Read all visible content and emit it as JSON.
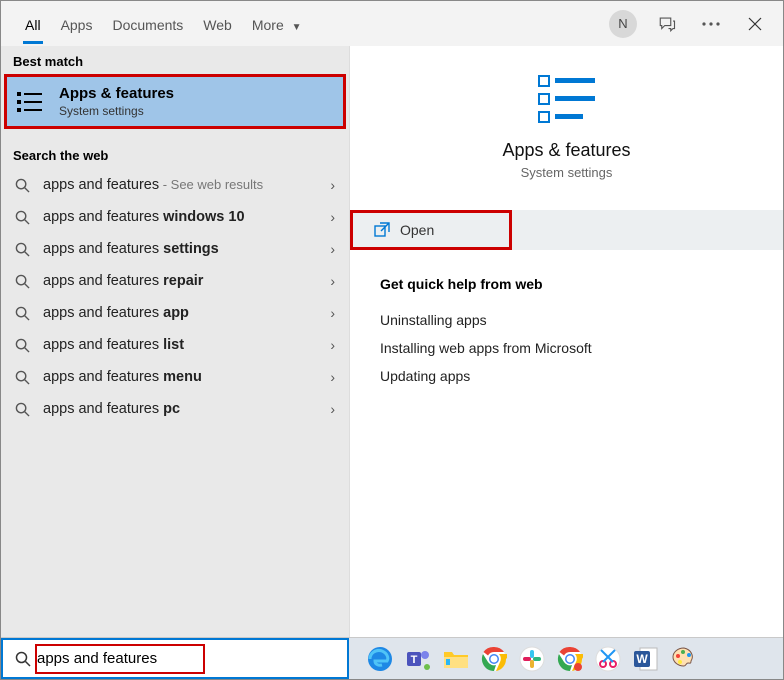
{
  "tabs": {
    "all": "All",
    "apps": "Apps",
    "documents": "Documents",
    "web": "Web",
    "more": "More"
  },
  "user_initial": "N",
  "sections": {
    "best_match": "Best match",
    "search_web": "Search the web"
  },
  "best_match": {
    "title": "Apps & features",
    "subtitle": "System settings"
  },
  "web_results": [
    {
      "prefix": "apps and features",
      "bold": "",
      "hint": " - See web results"
    },
    {
      "prefix": "apps and features ",
      "bold": "windows 10",
      "hint": ""
    },
    {
      "prefix": "apps and features ",
      "bold": "settings",
      "hint": ""
    },
    {
      "prefix": "apps and features ",
      "bold": "repair",
      "hint": ""
    },
    {
      "prefix": "apps and features ",
      "bold": "app",
      "hint": ""
    },
    {
      "prefix": "apps and features ",
      "bold": "list",
      "hint": ""
    },
    {
      "prefix": "apps and features ",
      "bold": "menu",
      "hint": ""
    },
    {
      "prefix": "apps and features ",
      "bold": "pc",
      "hint": ""
    }
  ],
  "preview": {
    "title": "Apps & features",
    "subtitle": "System settings",
    "open": "Open"
  },
  "help": {
    "header": "Get quick help from web",
    "links": [
      "Uninstalling apps",
      "Installing web apps from Microsoft",
      "Updating apps"
    ]
  },
  "search": {
    "value": "apps and features"
  }
}
